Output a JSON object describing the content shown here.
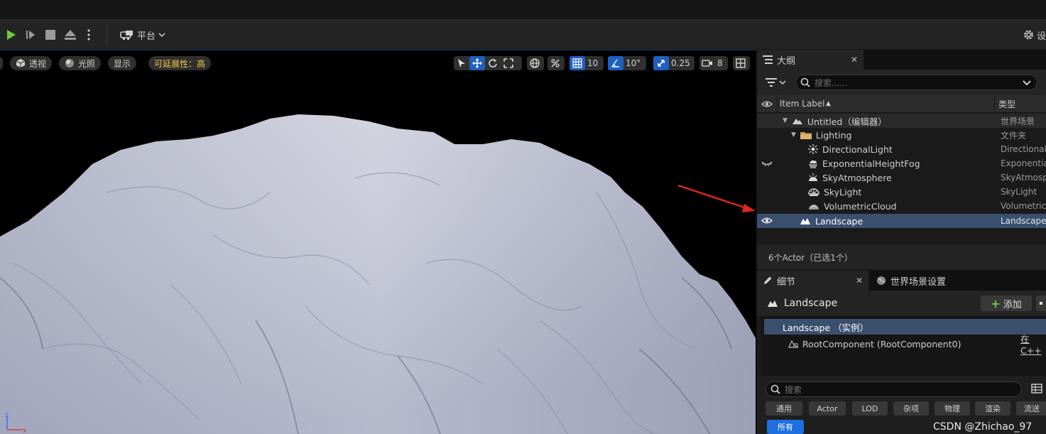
{
  "toolbar": {
    "platform_label": "平台",
    "right_label": "设"
  },
  "viewport": {
    "view_mode": "透视",
    "lit_mode": "光照",
    "show_label": "显示",
    "scalability": "可延展性：高",
    "grid_snap": "10",
    "rotation_snap": "10°",
    "scale_snap": "0.25",
    "camera_speed": "8"
  },
  "outliner": {
    "tab_title": "大纲",
    "search_placeholder": "搜索......",
    "columns": {
      "label": "Item Label",
      "type": "类型"
    },
    "rows": [
      {
        "label": "Untitled（编辑器）",
        "type": "世界场景"
      },
      {
        "label": "Lighting",
        "type": "文件夹"
      },
      {
        "label": "DirectionalLight",
        "type": "DirectionalL"
      },
      {
        "label": "ExponentialHeightFog",
        "type": "Exponential"
      },
      {
        "label": "SkyAtmosphere",
        "type": "SkyAtmosp"
      },
      {
        "label": "SkyLight",
        "type": "SkyLight"
      },
      {
        "label": "VolumetricCloud",
        "type": "Volumetric"
      },
      {
        "label": "Landscape",
        "type": "Landscape"
      }
    ],
    "status": "6个Actor（已选1个）"
  },
  "details": {
    "tab_title": "细节",
    "tab2_title": "世界场景设置",
    "actor_name": "Landscape",
    "add_label": "添加",
    "instance_label": "Landscape （实例）",
    "component_label": "RootComponent (RootComponent0)",
    "component_link": "在C++",
    "search_placeholder": "搜索",
    "filters": [
      "通用",
      "Actor",
      "LOD",
      "杂项",
      "物理",
      "渲染",
      "流送"
    ],
    "filter_all": "所有"
  },
  "watermark": "CSDN @Zhichao_97",
  "colors": {
    "accent": "#1f6fe0",
    "selection": "#3b4f6e",
    "warning": "#f5c542",
    "play": "#6ccb3a"
  }
}
